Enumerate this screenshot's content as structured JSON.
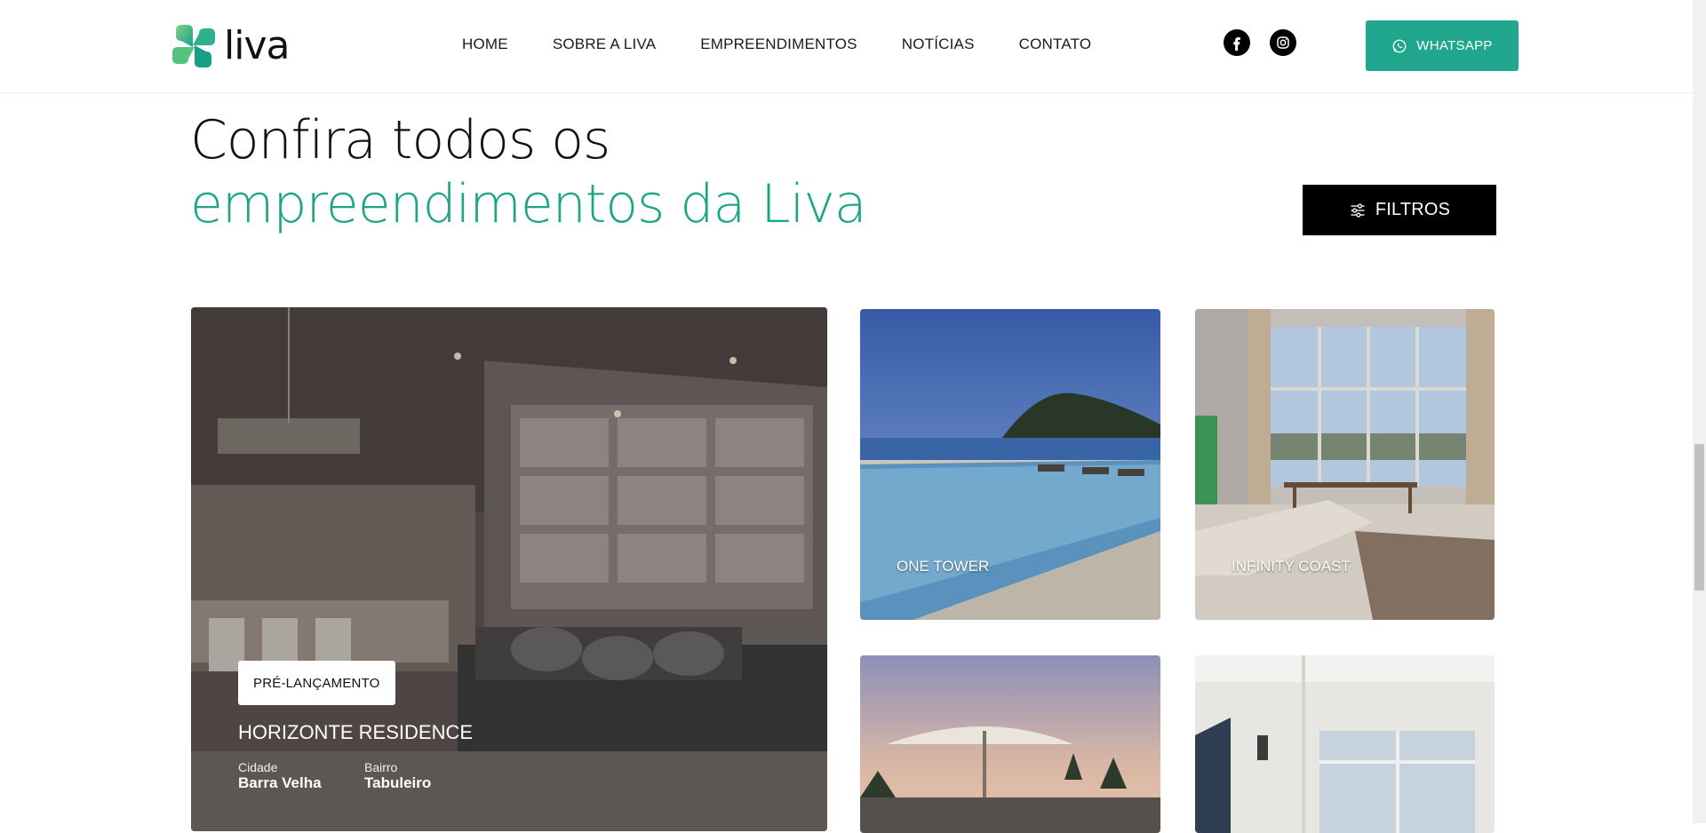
{
  "header": {
    "logo_text": "liva",
    "nav": [
      "HOME",
      "SOBRE A LIVA",
      "EMPREENDIMENTOS",
      "NOTÍCIAS",
      "CONTATO"
    ],
    "whatsapp_label": "WHATSAPP"
  },
  "hero": {
    "line1": "Confira todos os",
    "line2": "empreendimentos da Liva",
    "filters_label": "FILTROS"
  },
  "featured": {
    "badge": "PRÉ-LANÇAMENTO",
    "title": "HORIZONTE RESIDENCE",
    "city_label": "Cidade",
    "city_value": "Barra Velha",
    "neighborhood_label": "Bairro",
    "neighborhood_value": "Tabuleiro"
  },
  "cards": [
    {
      "title": "ONE TOWER"
    },
    {
      "title": "INFINITY COAST"
    }
  ],
  "colors": {
    "accent": "#1ea585",
    "whatsapp_bg": "#20a78d",
    "filters_bg": "#000000"
  }
}
